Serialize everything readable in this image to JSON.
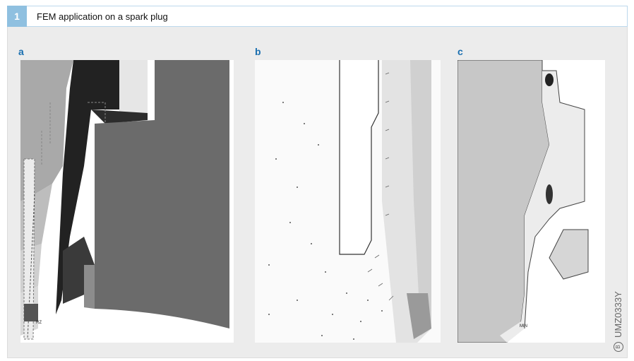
{
  "figure": {
    "number": "1",
    "title": "FEM application on a spark plug"
  },
  "panels": [
    {
      "label": "a"
    },
    {
      "label": "b"
    },
    {
      "label": "c"
    }
  ],
  "panel_a_tags": {
    "lower": "RZ"
  },
  "panel_c_tags": {
    "lower": "MIN"
  },
  "watermark": {
    "code": "UMZ0333Y",
    "logo": "B"
  }
}
